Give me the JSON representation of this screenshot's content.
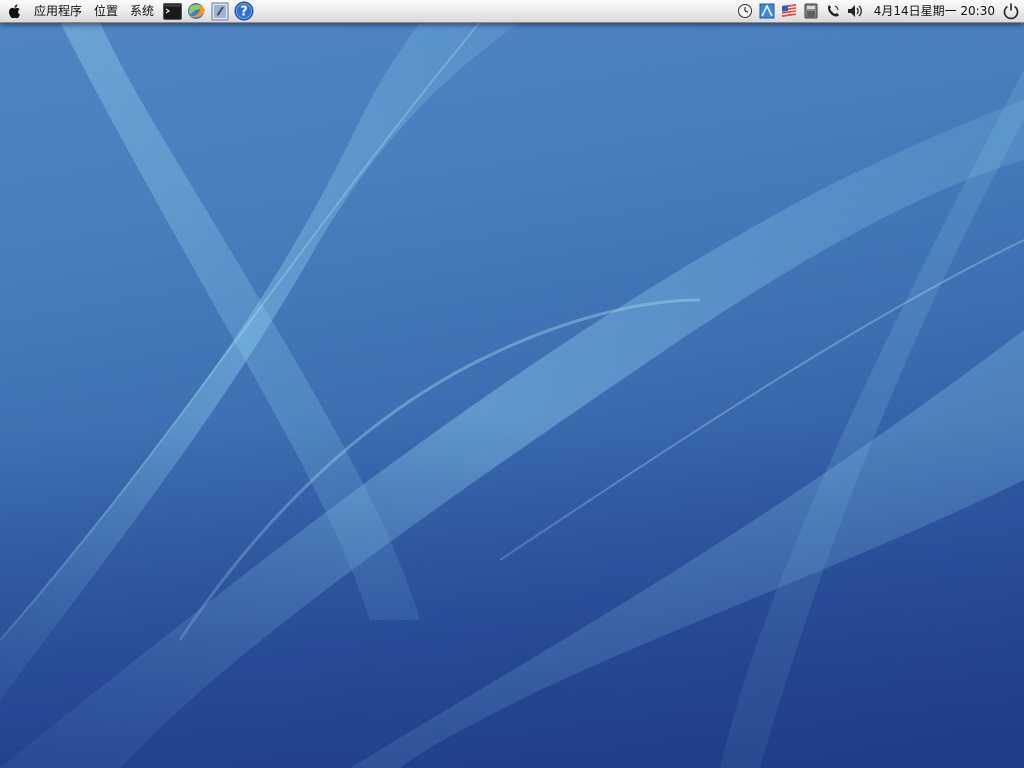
{
  "panel": {
    "menus": [
      {
        "label": "应用程序"
      },
      {
        "label": "位置"
      },
      {
        "label": "系统"
      }
    ],
    "launchers": [
      {
        "icon": "terminal-icon"
      },
      {
        "icon": "browser-icon"
      },
      {
        "icon": "text-editor-icon"
      },
      {
        "icon": "help-icon"
      }
    ],
    "tray": [
      {
        "icon": "clock-applet-icon"
      },
      {
        "icon": "network-icon"
      },
      {
        "icon": "input-method-flag-icon"
      },
      {
        "icon": "storage-icon"
      },
      {
        "icon": "phone-icon"
      },
      {
        "icon": "volume-icon"
      }
    ],
    "clock": "4月14日星期一 20:30"
  },
  "colors": {
    "panel_top": "#fbfbfb",
    "panel_bottom": "#d9d9d9",
    "wallpaper_light": "#6aa6d6",
    "wallpaper_dark": "#213f86"
  }
}
